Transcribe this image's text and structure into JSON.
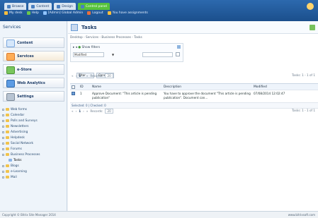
{
  "header": {
    "tabs": [
      {
        "label": "Browse",
        "active": false
      },
      {
        "label": "Content",
        "active": false
      },
      {
        "label": "Design",
        "active": false
      },
      {
        "label": "Control panel",
        "active": true
      }
    ],
    "links": [
      {
        "label": "My desk"
      },
      {
        "label": "Help"
      },
      {
        "label": "[Admin] Global Admin"
      },
      {
        "label": "Logout"
      },
      {
        "label": "You have assignments"
      }
    ]
  },
  "sidebar": {
    "title": "Services",
    "sections": [
      {
        "label": "Content",
        "active": false
      },
      {
        "label": "Services",
        "active": true
      },
      {
        "label": "e-Store",
        "active": false
      },
      {
        "label": "Web Analytics",
        "active": false
      },
      {
        "label": "Settings",
        "active": false
      }
    ],
    "tree": [
      {
        "label": "Web forms",
        "child": false
      },
      {
        "label": "Calendar",
        "child": false
      },
      {
        "label": "Polls and Surveys",
        "child": false
      },
      {
        "label": "Newsletters",
        "child": false
      },
      {
        "label": "Advertising",
        "child": false
      },
      {
        "label": "Helpdesk",
        "child": false
      },
      {
        "label": "Social Network",
        "child": false
      },
      {
        "label": "Forums",
        "child": false
      },
      {
        "label": "Business Processes",
        "child": false
      },
      {
        "label": "Tasks",
        "child": true,
        "selected": true
      },
      {
        "label": "Blogs",
        "child": false
      },
      {
        "label": "e-Learning",
        "child": false
      },
      {
        "label": "Mail",
        "child": false
      }
    ]
  },
  "main": {
    "title": "Tasks",
    "breadcrumb": "Desktop - Services - Business Processes - Tasks",
    "filter": {
      "heading": "Show filters",
      "field": "Modified",
      "date_value": "",
      "filter_button": "Filter",
      "cancel_button": "Cancel"
    },
    "pager": {
      "page": "1",
      "records_label": "Records:",
      "records_value": "20",
      "items_text": "Tasks: 1 - 1 of 1"
    },
    "grid": {
      "headers": [
        "",
        "ID",
        "Name",
        "Description",
        "Modified"
      ],
      "rows": [
        {
          "id": "1",
          "name": "Approve Document: \"This article is pending publication\"",
          "description": "You have to approve the document \"This article is pending publication\". Document can...",
          "modified": "07/08/2014 12:02:47"
        }
      ],
      "footer": "Selected: 0 | Checked: 0"
    }
  },
  "status": {
    "left": "Copyright © Bitrix Site Manager 2014",
    "right": "www.bitrixsoft.com"
  }
}
